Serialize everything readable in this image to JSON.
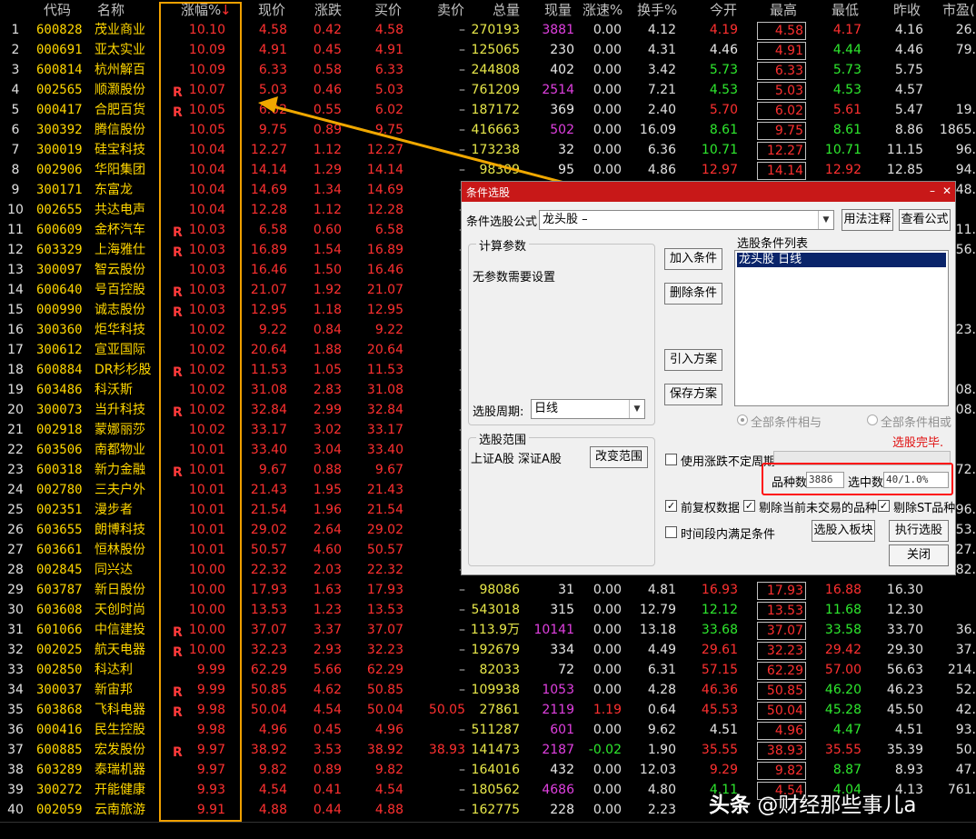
{
  "headers": {
    "code": "代码",
    "name": "名称",
    "chg": "涨幅%",
    "sort_mark": "↓",
    "price": "现价",
    "diff": "涨跌",
    "bid": "买价",
    "ask": "卖价",
    "volume": "总量",
    "cur": "现量",
    "speed": "涨速%",
    "turnover": "换手%",
    "open": "今开",
    "high": "最高",
    "low": "最低",
    "prev": "昨收",
    "pe": "市盈("
  },
  "r_mark": "R",
  "rows": [
    {
      "i": "1",
      "code": "600828",
      "name": "茂业商业",
      "r": "",
      "chg": "10.10",
      "price": "4.58",
      "diff": "0.42",
      "bid": "4.58",
      "ask": "–",
      "vol": "270193",
      "cur": "3881",
      "cur_c": "mag",
      "spd": "0.00",
      "turn": "4.12",
      "open": "4.19",
      "open_c": "red",
      "high": "4.58",
      "low": "4.17",
      "low_c": "red",
      "prev": "4.16",
      "pe": "26."
    },
    {
      "i": "2",
      "code": "000691",
      "name": "亚太实业",
      "r": "",
      "chg": "10.09",
      "price": "4.91",
      "diff": "0.45",
      "bid": "4.91",
      "ask": "–",
      "vol": "125065",
      "cur": "230",
      "cur_c": "white",
      "spd": "0.00",
      "turn": "4.31",
      "open": "4.46",
      "open_c": "white",
      "high": "4.91",
      "low": "4.44",
      "low_c": "green",
      "prev": "4.46",
      "pe": "79."
    },
    {
      "i": "3",
      "code": "600814",
      "name": "杭州解百",
      "r": "",
      "chg": "10.09",
      "price": "6.33",
      "diff": "0.58",
      "bid": "6.33",
      "ask": "–",
      "vol": "244808",
      "cur": "402",
      "cur_c": "white",
      "spd": "0.00",
      "turn": "3.42",
      "open": "5.73",
      "open_c": "green",
      "high": "6.33",
      "low": "5.73",
      "low_c": "green",
      "prev": "5.75",
      "pe": ""
    },
    {
      "i": "4",
      "code": "002565",
      "name": "顺灏股份",
      "r": "R",
      "chg": "10.07",
      "price": "5.03",
      "diff": "0.46",
      "bid": "5.03",
      "ask": "–",
      "vol": "761209",
      "cur": "2514",
      "cur_c": "mag",
      "spd": "0.00",
      "turn": "7.21",
      "open": "4.53",
      "open_c": "green",
      "high": "5.03",
      "low": "4.53",
      "low_c": "green",
      "prev": "4.57",
      "pe": ""
    },
    {
      "i": "5",
      "code": "000417",
      "name": "合肥百货",
      "r": "R",
      "chg": "10.05",
      "price": "6.02",
      "diff": "0.55",
      "bid": "6.02",
      "ask": "–",
      "vol": "187172",
      "cur": "369",
      "cur_c": "white",
      "spd": "0.00",
      "turn": "2.40",
      "open": "5.70",
      "open_c": "red",
      "high": "6.02",
      "low": "5.61",
      "low_c": "red",
      "prev": "5.47",
      "pe": "19."
    },
    {
      "i": "6",
      "code": "300392",
      "name": "腾信股份",
      "r": "",
      "chg": "10.05",
      "price": "9.75",
      "diff": "0.89",
      "bid": "9.75",
      "ask": "–",
      "vol": "416663",
      "cur": "502",
      "cur_c": "mag",
      "spd": "0.00",
      "turn": "16.09",
      "open": "8.61",
      "open_c": "green",
      "high": "9.75",
      "low": "8.61",
      "low_c": "green",
      "prev": "8.86",
      "pe": "1865."
    },
    {
      "i": "7",
      "code": "300019",
      "name": "硅宝科技",
      "r": "",
      "chg": "10.04",
      "price": "12.27",
      "diff": "1.12",
      "bid": "12.27",
      "ask": "–",
      "vol": "173238",
      "cur": "32",
      "cur_c": "white",
      "spd": "0.00",
      "turn": "6.36",
      "open": "10.71",
      "open_c": "green",
      "high": "12.27",
      "low": "10.71",
      "low_c": "green",
      "prev": "11.15",
      "pe": "96."
    },
    {
      "i": "8",
      "code": "002906",
      "name": "华阳集团",
      "r": "",
      "chg": "10.04",
      "price": "14.14",
      "diff": "1.29",
      "bid": "14.14",
      "ask": "–",
      "vol": "98309",
      "cur": "95",
      "cur_c": "white",
      "spd": "0.00",
      "turn": "4.86",
      "open": "12.97",
      "open_c": "red",
      "high": "14.14",
      "low": "12.92",
      "low_c": "red",
      "prev": "12.85",
      "pe": "94."
    },
    {
      "i": "9",
      "code": "300171",
      "name": "东富龙",
      "r": "",
      "chg": "10.04",
      "price": "14.69",
      "diff": "1.34",
      "bid": "14.69",
      "ask": "–",
      "vol": "",
      "cur": "",
      "cur_c": "white",
      "spd": "",
      "turn": "",
      "open": "",
      "open_c": "red",
      "high": "",
      "low": "",
      "low_c": "red",
      "prev": "",
      "pe": "48."
    },
    {
      "i": "10",
      "code": "002655",
      "name": "共达电声",
      "r": "",
      "chg": "10.04",
      "price": "12.28",
      "diff": "1.12",
      "bid": "12.28",
      "ask": "–",
      "vol": "",
      "cur": "",
      "cur_c": "white",
      "spd": "",
      "turn": "",
      "open": "",
      "open_c": "red",
      "high": "",
      "low": "",
      "low_c": "red",
      "prev": "",
      "pe": ""
    },
    {
      "i": "11",
      "code": "600609",
      "name": "金杯汽车",
      "r": "R",
      "chg": "10.03",
      "price": "6.58",
      "diff": "0.60",
      "bid": "6.58",
      "ask": "–",
      "vol": "",
      "cur": "",
      "cur_c": "white",
      "spd": "",
      "turn": "",
      "open": "",
      "open_c": "red",
      "high": "",
      "low": "",
      "low_c": "red",
      "prev": "",
      "pe": "711."
    },
    {
      "i": "12",
      "code": "603329",
      "name": "上海雅仕",
      "r": "R",
      "chg": "10.03",
      "price": "16.89",
      "diff": "1.54",
      "bid": "16.89",
      "ask": "–",
      "vol": "",
      "cur": "",
      "cur_c": "white",
      "spd": "",
      "turn": "",
      "open": "",
      "open_c": "red",
      "high": "",
      "low": "",
      "low_c": "red",
      "prev": "",
      "pe": "56."
    },
    {
      "i": "13",
      "code": "300097",
      "name": "智云股份",
      "r": "",
      "chg": "10.03",
      "price": "16.46",
      "diff": "1.50",
      "bid": "16.46",
      "ask": "–",
      "vol": "",
      "cur": "",
      "cur_c": "white",
      "spd": "",
      "turn": "",
      "open": "",
      "open_c": "red",
      "high": "",
      "low": "",
      "low_c": "red",
      "prev": "",
      "pe": ""
    },
    {
      "i": "14",
      "code": "600640",
      "name": "号百控股",
      "r": "R",
      "chg": "10.03",
      "price": "21.07",
      "diff": "1.92",
      "bid": "21.07",
      "ask": "–",
      "vol": "",
      "cur": "",
      "cur_c": "white",
      "spd": "",
      "turn": "",
      "open": "",
      "open_c": "red",
      "high": "",
      "low": "",
      "low_c": "red",
      "prev": "",
      "pe": ""
    },
    {
      "i": "15",
      "code": "000990",
      "name": "诚志股份",
      "r": "R",
      "chg": "10.03",
      "price": "12.95",
      "diff": "1.18",
      "bid": "12.95",
      "ask": "–",
      "vol": "",
      "cur": "",
      "cur_c": "white",
      "spd": "",
      "turn": "",
      "open": "",
      "open_c": "red",
      "high": "",
      "low": "",
      "low_c": "red",
      "prev": "",
      "pe": ""
    },
    {
      "i": "16",
      "code": "300360",
      "name": "炬华科技",
      "r": "",
      "chg": "10.02",
      "price": "9.22",
      "diff": "0.84",
      "bid": "9.22",
      "ask": "–",
      "vol": "",
      "cur": "",
      "cur_c": "white",
      "spd": "",
      "turn": "",
      "open": "",
      "open_c": "red",
      "high": "",
      "low": "",
      "low_c": "red",
      "prev": "",
      "pe": "23."
    },
    {
      "i": "17",
      "code": "300612",
      "name": "宣亚国际",
      "r": "",
      "chg": "10.02",
      "price": "20.64",
      "diff": "1.88",
      "bid": "20.64",
      "ask": "–",
      "vol": "",
      "cur": "",
      "cur_c": "white",
      "spd": "",
      "turn": "",
      "open": "",
      "open_c": "red",
      "high": "",
      "low": "",
      "low_c": "red",
      "prev": "",
      "pe": ""
    },
    {
      "i": "18",
      "code": "600884",
      "name": "DR杉杉股",
      "r": "R",
      "chg": "10.02",
      "price": "11.53",
      "diff": "1.05",
      "bid": "11.53",
      "ask": "–",
      "vol": "",
      "cur": "",
      "cur_c": "white",
      "spd": "",
      "turn": "",
      "open": "",
      "open_c": "red",
      "high": "",
      "low": "",
      "low_c": "red",
      "prev": "",
      "pe": ""
    },
    {
      "i": "19",
      "code": "603486",
      "name": "科沃斯",
      "r": "",
      "chg": "10.02",
      "price": "31.08",
      "diff": "2.83",
      "bid": "31.08",
      "ask": "–",
      "vol": "",
      "cur": "",
      "cur_c": "white",
      "spd": "",
      "turn": "",
      "open": "",
      "open_c": "red",
      "high": "",
      "low": "",
      "low_c": "red",
      "prev": "",
      "pe": "08."
    },
    {
      "i": "20",
      "code": "300073",
      "name": "当升科技",
      "r": "R",
      "chg": "10.02",
      "price": "32.84",
      "diff": "2.99",
      "bid": "32.84",
      "ask": "–",
      "vol": "",
      "cur": "",
      "cur_c": "white",
      "spd": "",
      "turn": "",
      "open": "",
      "open_c": "red",
      "high": "",
      "low": "",
      "low_c": "red",
      "prev": "",
      "pe": "08."
    },
    {
      "i": "21",
      "code": "002918",
      "name": "蒙娜丽莎",
      "r": "",
      "chg": "10.02",
      "price": "33.17",
      "diff": "3.02",
      "bid": "33.17",
      "ask": "–",
      "vol": "",
      "cur": "",
      "cur_c": "white",
      "spd": "",
      "turn": "",
      "open": "",
      "open_c": "red",
      "high": "",
      "low": "",
      "low_c": "red",
      "prev": "",
      "pe": ""
    },
    {
      "i": "22",
      "code": "603506",
      "name": "南都物业",
      "r": "",
      "chg": "10.01",
      "price": "33.40",
      "diff": "3.04",
      "bid": "33.40",
      "ask": "–",
      "vol": "",
      "cur": "",
      "cur_c": "white",
      "spd": "",
      "turn": "",
      "open": "",
      "open_c": "red",
      "high": "",
      "low": "",
      "low_c": "red",
      "prev": "",
      "pe": ""
    },
    {
      "i": "23",
      "code": "600318",
      "name": "新力金融",
      "r": "R",
      "chg": "10.01",
      "price": "9.67",
      "diff": "0.88",
      "bid": "9.67",
      "ask": "–",
      "vol": "",
      "cur": "",
      "cur_c": "white",
      "spd": "",
      "turn": "",
      "open": "",
      "open_c": "red",
      "high": "",
      "low": "",
      "low_c": "red",
      "prev": "",
      "pe": "272."
    },
    {
      "i": "24",
      "code": "002780",
      "name": "三夫户外",
      "r": "",
      "chg": "10.01",
      "price": "21.43",
      "diff": "1.95",
      "bid": "21.43",
      "ask": "–",
      "vol": "",
      "cur": "",
      "cur_c": "white",
      "spd": "",
      "turn": "",
      "open": "",
      "open_c": "red",
      "high": "",
      "low": "",
      "low_c": "red",
      "prev": "",
      "pe": ""
    },
    {
      "i": "25",
      "code": "002351",
      "name": "漫步者",
      "r": "",
      "chg": "10.01",
      "price": "21.54",
      "diff": "1.96",
      "bid": "21.54",
      "ask": "–",
      "vol": "",
      "cur": "",
      "cur_c": "white",
      "spd": "",
      "turn": "",
      "open": "",
      "open_c": "red",
      "high": "",
      "low": "",
      "low_c": "red",
      "prev": "",
      "pe": "96."
    },
    {
      "i": "26",
      "code": "603655",
      "name": "朗博科技",
      "r": "",
      "chg": "10.01",
      "price": "29.02",
      "diff": "2.64",
      "bid": "29.02",
      "ask": "–",
      "vol": "",
      "cur": "",
      "cur_c": "white",
      "spd": "",
      "turn": "",
      "open": "",
      "open_c": "red",
      "high": "",
      "low": "",
      "low_c": "red",
      "prev": "",
      "pe": "53."
    },
    {
      "i": "27",
      "code": "603661",
      "name": "恒林股份",
      "r": "",
      "chg": "10.01",
      "price": "50.57",
      "diff": "4.60",
      "bid": "50.57",
      "ask": "–",
      "vol": "",
      "cur": "",
      "cur_c": "white",
      "spd": "",
      "turn": "",
      "open": "",
      "open_c": "red",
      "high": "",
      "low": "",
      "low_c": "red",
      "prev": "",
      "pe": "27."
    },
    {
      "i": "28",
      "code": "002845",
      "name": "同兴达",
      "r": "",
      "chg": "10.00",
      "price": "22.32",
      "diff": "2.03",
      "bid": "22.32",
      "ask": "–",
      "vol": "",
      "cur": "",
      "cur_c": "white",
      "spd": "",
      "turn": "",
      "open": "",
      "open_c": "red",
      "high": "",
      "low": "",
      "low_c": "red",
      "prev": "",
      "pe": "82."
    },
    {
      "i": "29",
      "code": "603787",
      "name": "新日股份",
      "r": "",
      "chg": "10.00",
      "price": "17.93",
      "diff": "1.63",
      "bid": "17.93",
      "ask": "–",
      "vol": "98086",
      "cur": "31",
      "cur_c": "white",
      "spd": "0.00",
      "turn": "4.81",
      "open": "16.93",
      "open_c": "red",
      "high": "17.93",
      "low": "16.88",
      "low_c": "red",
      "prev": "16.30",
      "pe": ""
    },
    {
      "i": "30",
      "code": "603608",
      "name": "天创时尚",
      "r": "",
      "chg": "10.00",
      "price": "13.53",
      "diff": "1.23",
      "bid": "13.53",
      "ask": "–",
      "vol": "543018",
      "cur": "315",
      "cur_c": "white",
      "spd": "0.00",
      "turn": "12.79",
      "open": "12.12",
      "open_c": "green",
      "high": "13.53",
      "low": "11.68",
      "low_c": "green",
      "prev": "12.30",
      "pe": ""
    },
    {
      "i": "31",
      "code": "601066",
      "name": "中信建投",
      "r": "R",
      "chg": "10.00",
      "price": "37.07",
      "diff": "3.37",
      "bid": "37.07",
      "ask": "–",
      "vol": "113.9万",
      "cur": "10141",
      "cur_c": "mag",
      "spd": "0.00",
      "turn": "13.18",
      "open": "33.68",
      "open_c": "green",
      "high": "37.07",
      "low": "33.58",
      "low_c": "green",
      "prev": "33.70",
      "pe": "36."
    },
    {
      "i": "32",
      "code": "002025",
      "name": "航天电器",
      "r": "R",
      "chg": "10.00",
      "price": "32.23",
      "diff": "2.93",
      "bid": "32.23",
      "ask": "–",
      "vol": "192679",
      "cur": "334",
      "cur_c": "white",
      "spd": "0.00",
      "turn": "4.49",
      "open": "29.61",
      "open_c": "red",
      "high": "32.23",
      "low": "29.42",
      "low_c": "red",
      "prev": "29.30",
      "pe": "37."
    },
    {
      "i": "33",
      "code": "002850",
      "name": "科达利",
      "r": "",
      "chg": "9.99",
      "price": "62.29",
      "diff": "5.66",
      "bid": "62.29",
      "ask": "–",
      "vol": "82033",
      "cur": "72",
      "cur_c": "white",
      "spd": "0.00",
      "turn": "6.31",
      "open": "57.15",
      "open_c": "red",
      "high": "62.29",
      "low": "57.00",
      "low_c": "red",
      "prev": "56.63",
      "pe": "214."
    },
    {
      "i": "34",
      "code": "300037",
      "name": "新宙邦",
      "r": "R",
      "chg": "9.99",
      "price": "50.85",
      "diff": "4.62",
      "bid": "50.85",
      "ask": "–",
      "vol": "109938",
      "cur": "1053",
      "cur_c": "mag",
      "spd": "0.00",
      "turn": "4.28",
      "open": "46.36",
      "open_c": "red",
      "high": "50.85",
      "low": "46.20",
      "low_c": "green",
      "prev": "46.23",
      "pe": "52."
    },
    {
      "i": "35",
      "code": "603868",
      "name": "飞科电器",
      "r": "R",
      "chg": "9.98",
      "price": "50.04",
      "diff": "4.54",
      "bid": "50.04",
      "ask": "50.05",
      "vol": "27861",
      "cur": "2119",
      "cur_c": "mag",
      "spd": "1.19",
      "turn": "0.64",
      "open": "45.53",
      "open_c": "red",
      "high": "50.04",
      "low": "45.28",
      "low_c": "green",
      "prev": "45.50",
      "pe": "42."
    },
    {
      "i": "36",
      "code": "000416",
      "name": "民生控股",
      "r": "",
      "chg": "9.98",
      "price": "4.96",
      "diff": "0.45",
      "bid": "4.96",
      "ask": "–",
      "vol": "511287",
      "cur": "601",
      "cur_c": "mag",
      "spd": "0.00",
      "turn": "9.62",
      "open": "4.51",
      "open_c": "white",
      "high": "4.96",
      "low": "4.47",
      "low_c": "green",
      "prev": "4.51",
      "pe": "93."
    },
    {
      "i": "37",
      "code": "600885",
      "name": "宏发股份",
      "r": "R",
      "chg": "9.97",
      "price": "38.92",
      "diff": "3.53",
      "bid": "38.92",
      "ask": "38.93",
      "vol": "141473",
      "cur": "2187",
      "cur_c": "mag",
      "spd": "-0.02",
      "turn": "1.90",
      "open": "35.55",
      "open_c": "red",
      "high": "38.93",
      "low": "35.55",
      "low_c": "red",
      "prev": "35.39",
      "pe": "50."
    },
    {
      "i": "38",
      "code": "603289",
      "name": "泰瑞机器",
      "r": "",
      "chg": "9.97",
      "price": "9.82",
      "diff": "0.89",
      "bid": "9.82",
      "ask": "–",
      "vol": "164016",
      "cur": "432",
      "cur_c": "white",
      "spd": "0.00",
      "turn": "12.03",
      "open": "9.29",
      "open_c": "red",
      "high": "9.82",
      "low": "8.87",
      "low_c": "green",
      "prev": "8.93",
      "pe": "47."
    },
    {
      "i": "39",
      "code": "300272",
      "name": "开能健康",
      "r": "",
      "chg": "9.93",
      "price": "4.54",
      "diff": "0.41",
      "bid": "4.54",
      "ask": "–",
      "vol": "180562",
      "cur": "4686",
      "cur_c": "mag",
      "spd": "0.00",
      "turn": "4.80",
      "open": "4.11",
      "open_c": "green",
      "high": "4.54",
      "low": "4.04",
      "low_c": "green",
      "prev": "4.13",
      "pe": "761."
    },
    {
      "i": "40",
      "code": "002059",
      "name": "云南旅游",
      "r": "",
      "chg": "9.91",
      "price": "4.88",
      "diff": "0.44",
      "bid": "4.88",
      "ask": "–",
      "vol": "162775",
      "cur": "228",
      "cur_c": "white",
      "spd": "0.00",
      "turn": "2.23",
      "open": "",
      "open_c": "red",
      "high": "",
      "low": "",
      "low_c": "red",
      "prev": "",
      "pe": ""
    }
  ],
  "dialog": {
    "title": "条件选股",
    "minimize": "–",
    "close": "✕",
    "formula_label": "条件选股公式",
    "formula_value": "龙头股          –",
    "usage_button": "用法注释",
    "view_formula_button": "查看公式",
    "params_group": "计算参数",
    "params_text": "无参数需要设置",
    "add_condition": "加入条件",
    "delete_condition": "删除条件",
    "import_plan": "引入方案",
    "save_plan": "保存方案",
    "list_title": "选股条件列表",
    "list_items": [
      "龙头股   日线"
    ],
    "period_label": "选股周期:",
    "period_value": "日线",
    "scope_group": "选股范围",
    "scope_text": "上证A股  深证A股",
    "change_scope": "改变范围",
    "all_and": "全部条件相与",
    "all_or": "全部条件相或",
    "done_text": "选股完毕.",
    "use_uncertain_period": "使用涨跌不定周期",
    "count_label": "品种数",
    "count_value": "3886",
    "selected_label": "选中数",
    "selected_value": "40/1.0%",
    "pre_adjusted": "前复权数据",
    "exclude_untraded": "剔除当前未交易的品种",
    "exclude_st": "剔除ST品种",
    "time_satisfy": "时间段内满足条件",
    "to_sector": "选股入板块",
    "execute": "执行选股",
    "close_button": "关闭"
  },
  "watermark": {
    "brand": "头条",
    "text": "@财经那些事儿a"
  },
  "colors": {
    "accent_frame": "#f0a000",
    "title_bar": "#c81818",
    "highlight_box": "#ff1010",
    "up": "#ff3030",
    "down": "#2ee82e"
  }
}
